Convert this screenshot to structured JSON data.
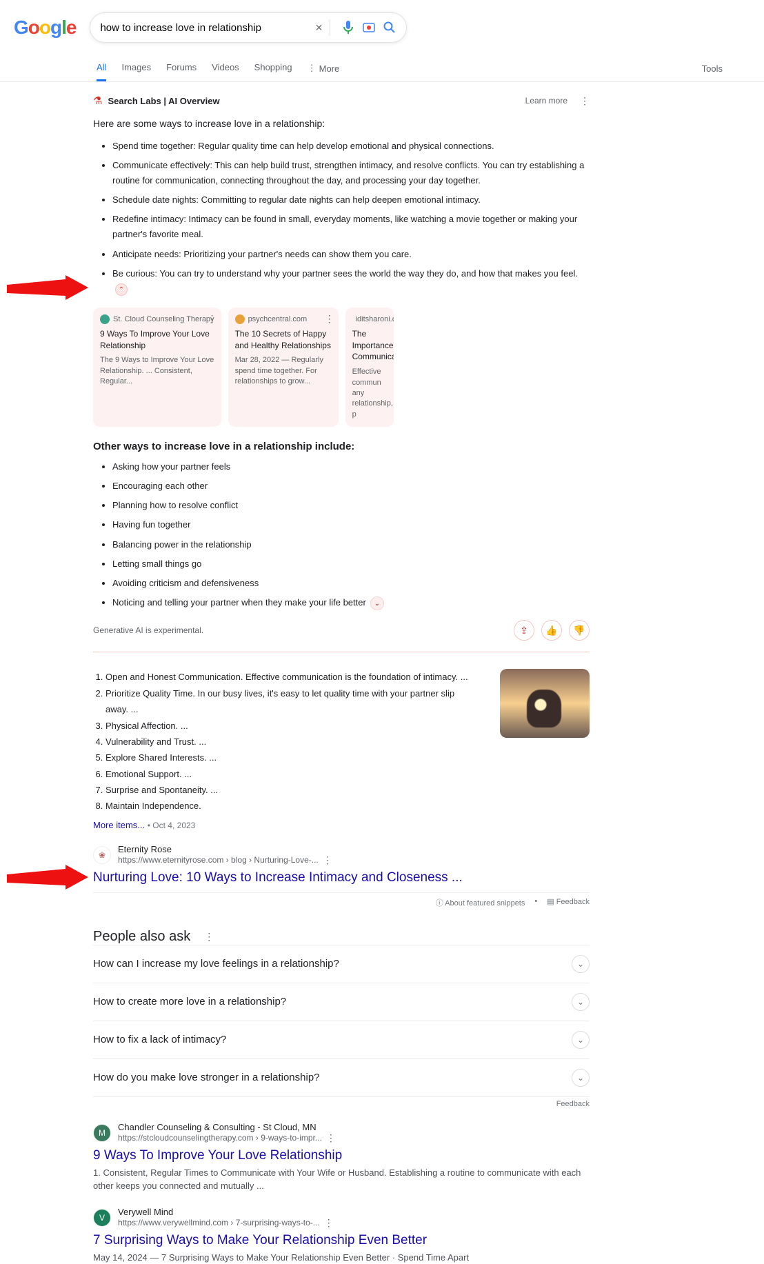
{
  "search": {
    "query": "how to increase love in relationship"
  },
  "tabs": {
    "all": "All",
    "images": "Images",
    "forums": "Forums",
    "videos": "Videos",
    "shopping": "Shopping",
    "more": "More",
    "tools": "Tools"
  },
  "ai": {
    "label": "Search Labs | AI Overview",
    "learn": "Learn more",
    "intro": "Here are some ways to increase love in a relationship:",
    "bullets": [
      "Spend time together: Regular quality time can help develop emotional and physical connections.",
      "Communicate effectively: This can help build trust, strengthen intimacy, and resolve conflicts. You can try establishing a routine for communication, connecting throughout the day, and processing your day together.",
      "Schedule date nights: Committing to regular date nights can help deepen emotional intimacy.",
      "Redefine intimacy: Intimacy can be found in small, everyday moments, like watching a movie together or making your partner's favorite meal.",
      "Anticipate needs: Prioritizing your partner's needs can show them you care.",
      "Be curious: You can try to understand why your partner sees the world the way they do, and how that makes you feel."
    ],
    "cards": [
      {
        "src": "St. Cloud Counseling Therapy",
        "title": "9 Ways To Improve Your Love Relationship",
        "snip": "The 9 Ways to Improve Your Love Relationship. ... Consistent, Regular...",
        "color": "#3aa38a"
      },
      {
        "src": "psychcentral.com",
        "title": "The 10 Secrets of Happy and Healthy Relationships",
        "snip": "Mar 28, 2022 — Regularly spend time together. For relationships to grow...",
        "color": "#e8a23a"
      },
      {
        "src": "iditsharoni.co",
        "title": "The Importance Communicati",
        "snip": "Effective commun any relationship, p",
        "color": "#b37bd1"
      }
    ],
    "subhead": "Other ways to increase love in a relationship include:",
    "bullets2": [
      "Asking how your partner feels",
      "Encouraging each other",
      "Planning how to resolve conflict",
      "Having fun together",
      "Balancing power in the relationship",
      "Letting small things go",
      "Avoiding criticism and defensiveness",
      "Noticing and telling your partner when they make your life better"
    ],
    "note": "Generative AI is experimental."
  },
  "featured": {
    "items": [
      "Open and Honest Communication. Effective communication is the foundation of intimacy. ...",
      "Prioritize Quality Time. In our busy lives, it's easy to let quality time with your partner slip away. ...",
      "Physical Affection. ...",
      "Vulnerability and Trust. ...",
      "Explore Shared Interests. ...",
      "Emotional Support. ...",
      "Surprise and Spontaneity. ...",
      "Maintain Independence."
    ],
    "more": "More items...",
    "date": "Oct 4, 2023",
    "site": "Eternity Rose",
    "url": "https://www.eternityrose.com › blog › Nurturing-Love-...",
    "title": "Nurturing Love: 10 Ways to Increase Intimacy and Closeness ...",
    "about": "About featured snippets",
    "feedback": "Feedback"
  },
  "paa": {
    "title": "People also ask",
    "q": [
      "How can I increase my love feelings in a relationship?",
      "How to create more love in a relationship?",
      "How to fix a lack of intimacy?",
      "How do you make love stronger in a relationship?"
    ],
    "feedback": "Feedback"
  },
  "results": [
    {
      "site": "Chandler Counseling & Consulting - St Cloud, MN",
      "url": "https://stcloudcounselingtherapy.com › 9-ways-to-impr...",
      "title": "9 Ways To Improve Your Love Relationship",
      "snip": "1. Consistent, Regular Times to Communicate with Your Wife or Husband. Establishing a routine to communicate with each other keeps you connected and mutually ...",
      "favbg": "#3a7a5f",
      "fav": "M"
    },
    {
      "site": "Verywell Mind",
      "url": "https://www.verywellmind.com › 7-surprising-ways-to-...",
      "title": "7 Surprising Ways to Make Your Relationship Even Better",
      "snip": "May 14, 2024 — 7 Surprising Ways to Make Your Relationship Even Better · Spend Time Apart",
      "favbg": "#1a7f5a",
      "fav": "V"
    }
  ]
}
